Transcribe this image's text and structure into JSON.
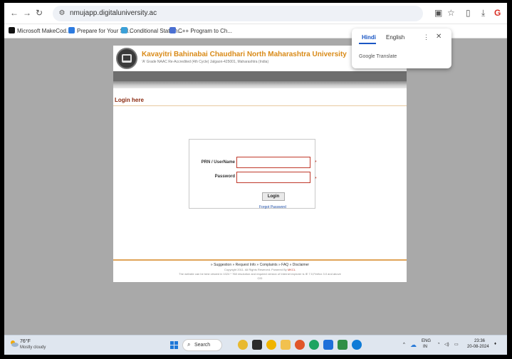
{
  "browser": {
    "url": "nmujapp.digitaluniversity.ac",
    "bookmarks": [
      {
        "label": "Microsoft MakeCod...",
        "color": "#111111"
      },
      {
        "label": "Prepare for Your Sal...",
        "color": "#2d7be0"
      },
      {
        "label": "Conditional Statem...",
        "color": "#3aa0d8"
      },
      {
        "label": "C++ Program to Ch...",
        "color": "#4a6fd1"
      }
    ]
  },
  "translate": {
    "lang_active": "Hindi",
    "lang_other": "English",
    "brand": "Google Translate"
  },
  "site": {
    "title": "Kavayitri Bahinabai Chaudhari North Maharashtra University",
    "subtitle": "'A' Grade NAAC Re-Accredited (4th Cycle) Jalgaon-425001, Maharashtra (India)",
    "title_color": "#d98a17"
  },
  "login": {
    "heading": "Login here",
    "prn_label": "PRN / UserName",
    "password_label": "Password",
    "required_mark": "*",
    "button": "Login",
    "forgot": "Forgot Password"
  },
  "footer": {
    "links": [
      "Suggestion",
      "Request Info",
      "Complaints",
      "FAQ",
      "Disclaimer"
    ],
    "copyright": "Copyright 2011. All Rights Reserved. Powered By",
    "powered_by": "MKCL",
    "note": "The website can be best viewed in 1024 * 768 resolution and required version of Internet explorer is IE 7.0,Firefox 3.0 and above",
    "cid": "CID"
  },
  "taskbar": {
    "temp": "76°F",
    "weather": "Mostly cloudy",
    "search": "Search",
    "lang": "ENG",
    "region": "IN",
    "time": "23:36",
    "date": "20-08-2024"
  }
}
